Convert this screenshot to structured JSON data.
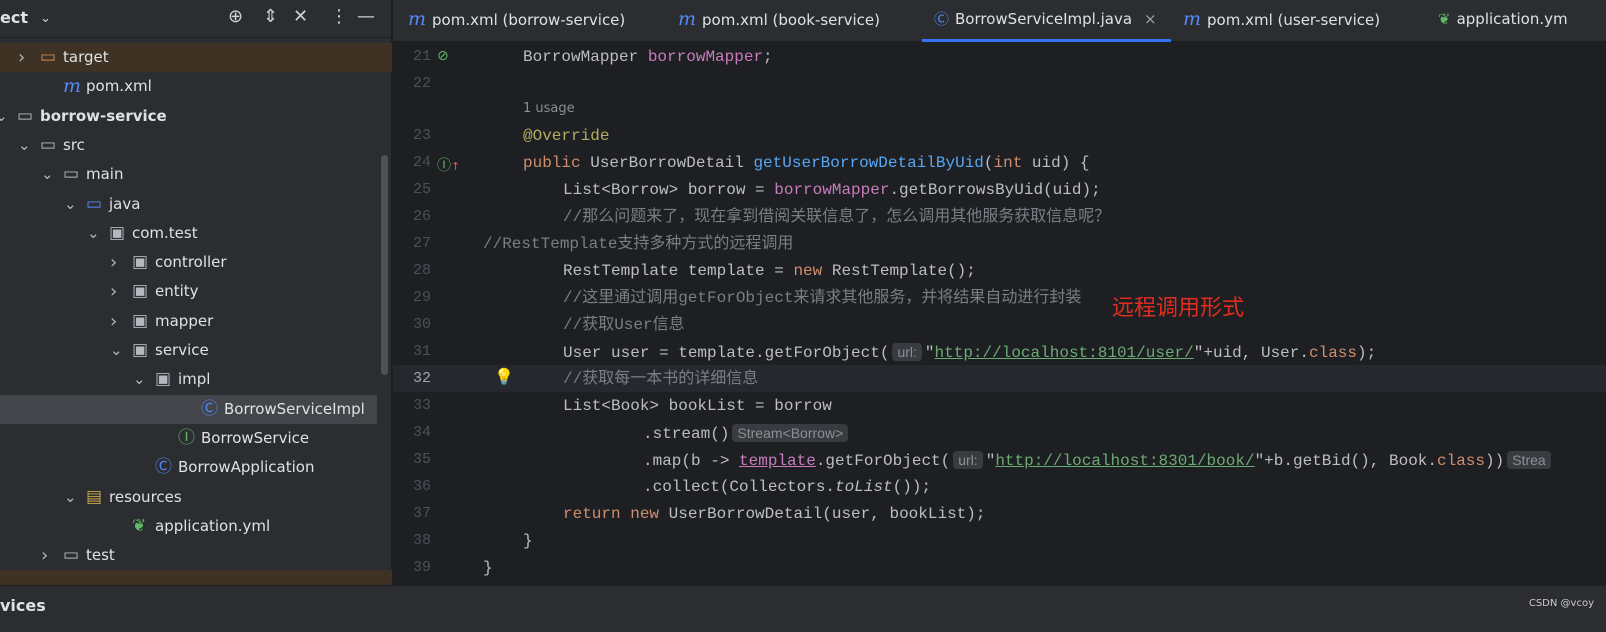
{
  "sidebar": {
    "title": "ect",
    "toolbar_icons": [
      "locate-icon",
      "expand-all-icon",
      "collapse-all-icon",
      "more-icon",
      "minimize-icon"
    ],
    "items": [
      {
        "label": "target",
        "icon": "folder-excluded",
        "indent": 0,
        "chevron": "right"
      },
      {
        "label": "pom.xml",
        "icon": "maven",
        "indent": 1,
        "chevron": ""
      },
      {
        "label": "borrow-service",
        "icon": "module",
        "indent": -1,
        "chevron": "down",
        "bold": true
      },
      {
        "label": "src",
        "icon": "folder",
        "indent": 0,
        "chevron": "down"
      },
      {
        "label": "main",
        "icon": "folder",
        "indent": 1,
        "chevron": "down"
      },
      {
        "label": "java",
        "icon": "source-folder",
        "indent": 2,
        "chevron": "down"
      },
      {
        "label": "com.test",
        "icon": "package",
        "indent": 3,
        "chevron": "down"
      },
      {
        "label": "controller",
        "icon": "package",
        "indent": 4,
        "chevron": "right"
      },
      {
        "label": "entity",
        "icon": "package",
        "indent": 4,
        "chevron": "right"
      },
      {
        "label": "mapper",
        "icon": "package",
        "indent": 4,
        "chevron": "right"
      },
      {
        "label": "service",
        "icon": "package",
        "indent": 4,
        "chevron": "down"
      },
      {
        "label": "impl",
        "icon": "package",
        "indent": 5,
        "chevron": "down"
      },
      {
        "label": "BorrowServiceImpl",
        "icon": "class",
        "indent": 7,
        "chevron": "",
        "selected": true
      },
      {
        "label": "BorrowService",
        "icon": "interface",
        "indent": 6,
        "chevron": ""
      },
      {
        "label": "BorrowApplication",
        "icon": "spring-class",
        "indent": 5,
        "chevron": ""
      },
      {
        "label": "resources",
        "icon": "resources-folder",
        "indent": 2,
        "chevron": "down"
      },
      {
        "label": "application.yml",
        "icon": "yaml",
        "indent": 4,
        "chevron": ""
      },
      {
        "label": "test",
        "icon": "folder",
        "indent": 1,
        "chevron": "right"
      }
    ]
  },
  "tabs": [
    {
      "label": "pom.xml (borrow-service)",
      "icon": "maven"
    },
    {
      "label": "pom.xml (book-service)",
      "icon": "maven"
    },
    {
      "label": "BorrowServiceImpl.java",
      "icon": "class",
      "active": true,
      "close": "×"
    },
    {
      "label": "pom.xml (user-service)",
      "icon": "maven"
    },
    {
      "label": "application.ym",
      "icon": "yaml"
    }
  ],
  "editor": {
    "usage_hint": "1 usage",
    "current_line": 32,
    "lines": [
      {
        "n": "21",
        "indent": 1,
        "t": [
          [
            "BorrowMapper ",
            ""
          ],
          [
            "borrowMapper",
            "f"
          ],
          [
            ";",
            ""
          ]
        ]
      },
      {
        "n": "22",
        "indent": 0,
        "t": []
      },
      {
        "n": "23",
        "indent": 1,
        "t": [
          [
            "@Override",
            "a"
          ]
        ]
      },
      {
        "n": "24",
        "indent": 1,
        "t": [
          [
            "public ",
            "k"
          ],
          [
            "UserBorrowDetail ",
            ""
          ],
          [
            "getUserBorrowDetailByUid",
            "md"
          ],
          [
            "(",
            ""
          ],
          [
            "int ",
            "k"
          ],
          [
            "uid) {",
            ""
          ]
        ]
      },
      {
        "n": "25",
        "indent": 2,
        "t": [
          [
            "List<Borrow> borrow = ",
            ""
          ],
          [
            "borrowMapper",
            "f"
          ],
          [
            ".getBorrowsByUid(uid);",
            ""
          ]
        ]
      },
      {
        "n": "26",
        "indent": 2,
        "t": [
          [
            "//那么问题来了，现在拿到借阅关联信息了，怎么调用其他服务获取信息呢？",
            "c"
          ]
        ]
      },
      {
        "n": "27",
        "indent": 0,
        "t": [
          [
            "//RestTemplate支持多种方式的远程调用",
            "c"
          ]
        ]
      },
      {
        "n": "28",
        "indent": 2,
        "t": [
          [
            "RestTemplate template = ",
            ""
          ],
          [
            "new ",
            "k"
          ],
          [
            "RestTemplate();",
            ""
          ]
        ]
      },
      {
        "n": "29",
        "indent": 2,
        "t": [
          [
            "//这里通过调用getForObject来请求其他服务，并将结果自动进行封装",
            "c"
          ]
        ]
      },
      {
        "n": "30",
        "indent": 2,
        "t": [
          [
            "//获取User信息",
            "c"
          ]
        ]
      },
      {
        "n": "31",
        "indent": 2,
        "t": [
          [
            "User user = template.getForObject(",
            ""
          ],
          [
            "url:",
            "hint"
          ],
          [
            "\"",
            ""
          ],
          [
            "http://localhost:8101/user/",
            "s"
          ],
          [
            "\"+uid, User.",
            ""
          ],
          [
            "class",
            "k"
          ],
          [
            ");",
            ""
          ]
        ]
      },
      {
        "n": "32",
        "indent": 2,
        "t": [
          [
            "//获取每一本书的详细信息",
            "c"
          ]
        ]
      },
      {
        "n": "33",
        "indent": 2,
        "t": [
          [
            "List<Book> bookList = borrow",
            ""
          ]
        ]
      },
      {
        "n": "34",
        "indent": 4,
        "t": [
          [
            ".stream()",
            ""
          ],
          [
            "Stream<Borrow>",
            "hint"
          ]
        ]
      },
      {
        "n": "35",
        "indent": 4,
        "t": [
          [
            ".map(b -> ",
            ""
          ],
          [
            "template",
            "u"
          ],
          [
            ".getForObject(",
            ""
          ],
          [
            "url:",
            "hint"
          ],
          [
            "\"",
            ""
          ],
          [
            "http://localhost:8301/book/",
            "s"
          ],
          [
            "\"+b.getBid(), Book.",
            ""
          ],
          [
            "class",
            "k"
          ],
          [
            "))",
            ""
          ],
          [
            "Strea",
            "hint"
          ]
        ]
      },
      {
        "n": "36",
        "indent": 4,
        "t": [
          [
            ".collect(Collectors.",
            ""
          ],
          [
            "toList",
            "it"
          ],
          [
            "());",
            ""
          ]
        ]
      },
      {
        "n": "37",
        "indent": 2,
        "t": [
          [
            "return ",
            "k"
          ],
          [
            "new ",
            "k"
          ],
          [
            "UserBorrowDetail(user, bookList);",
            ""
          ]
        ]
      },
      {
        "n": "38",
        "indent": 1,
        "t": [
          [
            "}",
            ""
          ]
        ]
      },
      {
        "n": "39",
        "indent": 0,
        "t": [
          [
            "}",
            ""
          ]
        ]
      }
    ]
  },
  "annotation": "远程调用形式",
  "bottom": {
    "title": "vices",
    "watermark": "CSDN @vcoy"
  },
  "colors": {
    "accent": "#3574f0",
    "annotation": "#e32c20",
    "keyword": "#cf8e6d",
    "string": "#6aab73",
    "field": "#c77dbb",
    "method": "#56a8f5"
  }
}
